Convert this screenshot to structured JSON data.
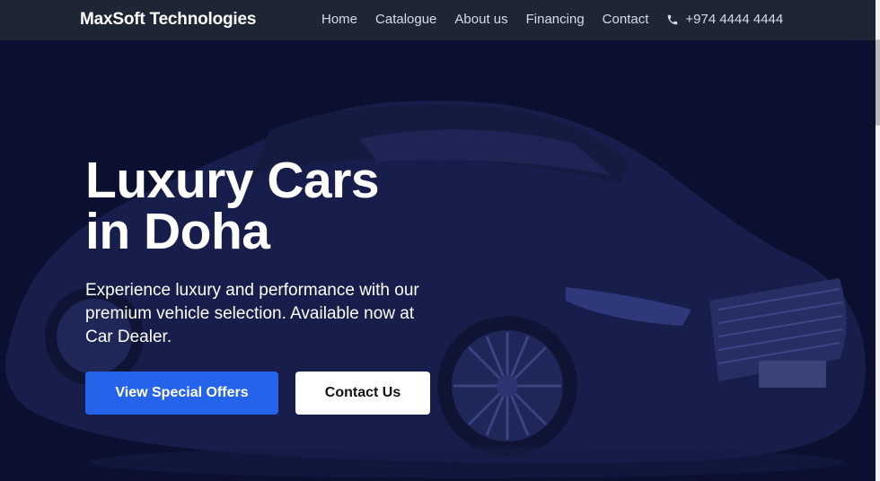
{
  "navbar": {
    "brand": "MaxSoft Technologies",
    "links": [
      "Home",
      "Catalogue",
      "About us",
      "Financing",
      "Contact"
    ],
    "phone": "+974 4444 4444",
    "phone_icon": "phone-icon"
  },
  "hero": {
    "title_line1": "Luxury Cars",
    "title_line2": "in Doha",
    "subtitle": "Experience luxury and performance with our premium vehicle selection. Available now at Car Dealer.",
    "primary_button": "View Special Offers",
    "secondary_button": "Contact Us"
  },
  "colors": {
    "navbar_bg": "#1e2535",
    "hero_bg": "#0b1030",
    "accent": "#2563eb"
  }
}
